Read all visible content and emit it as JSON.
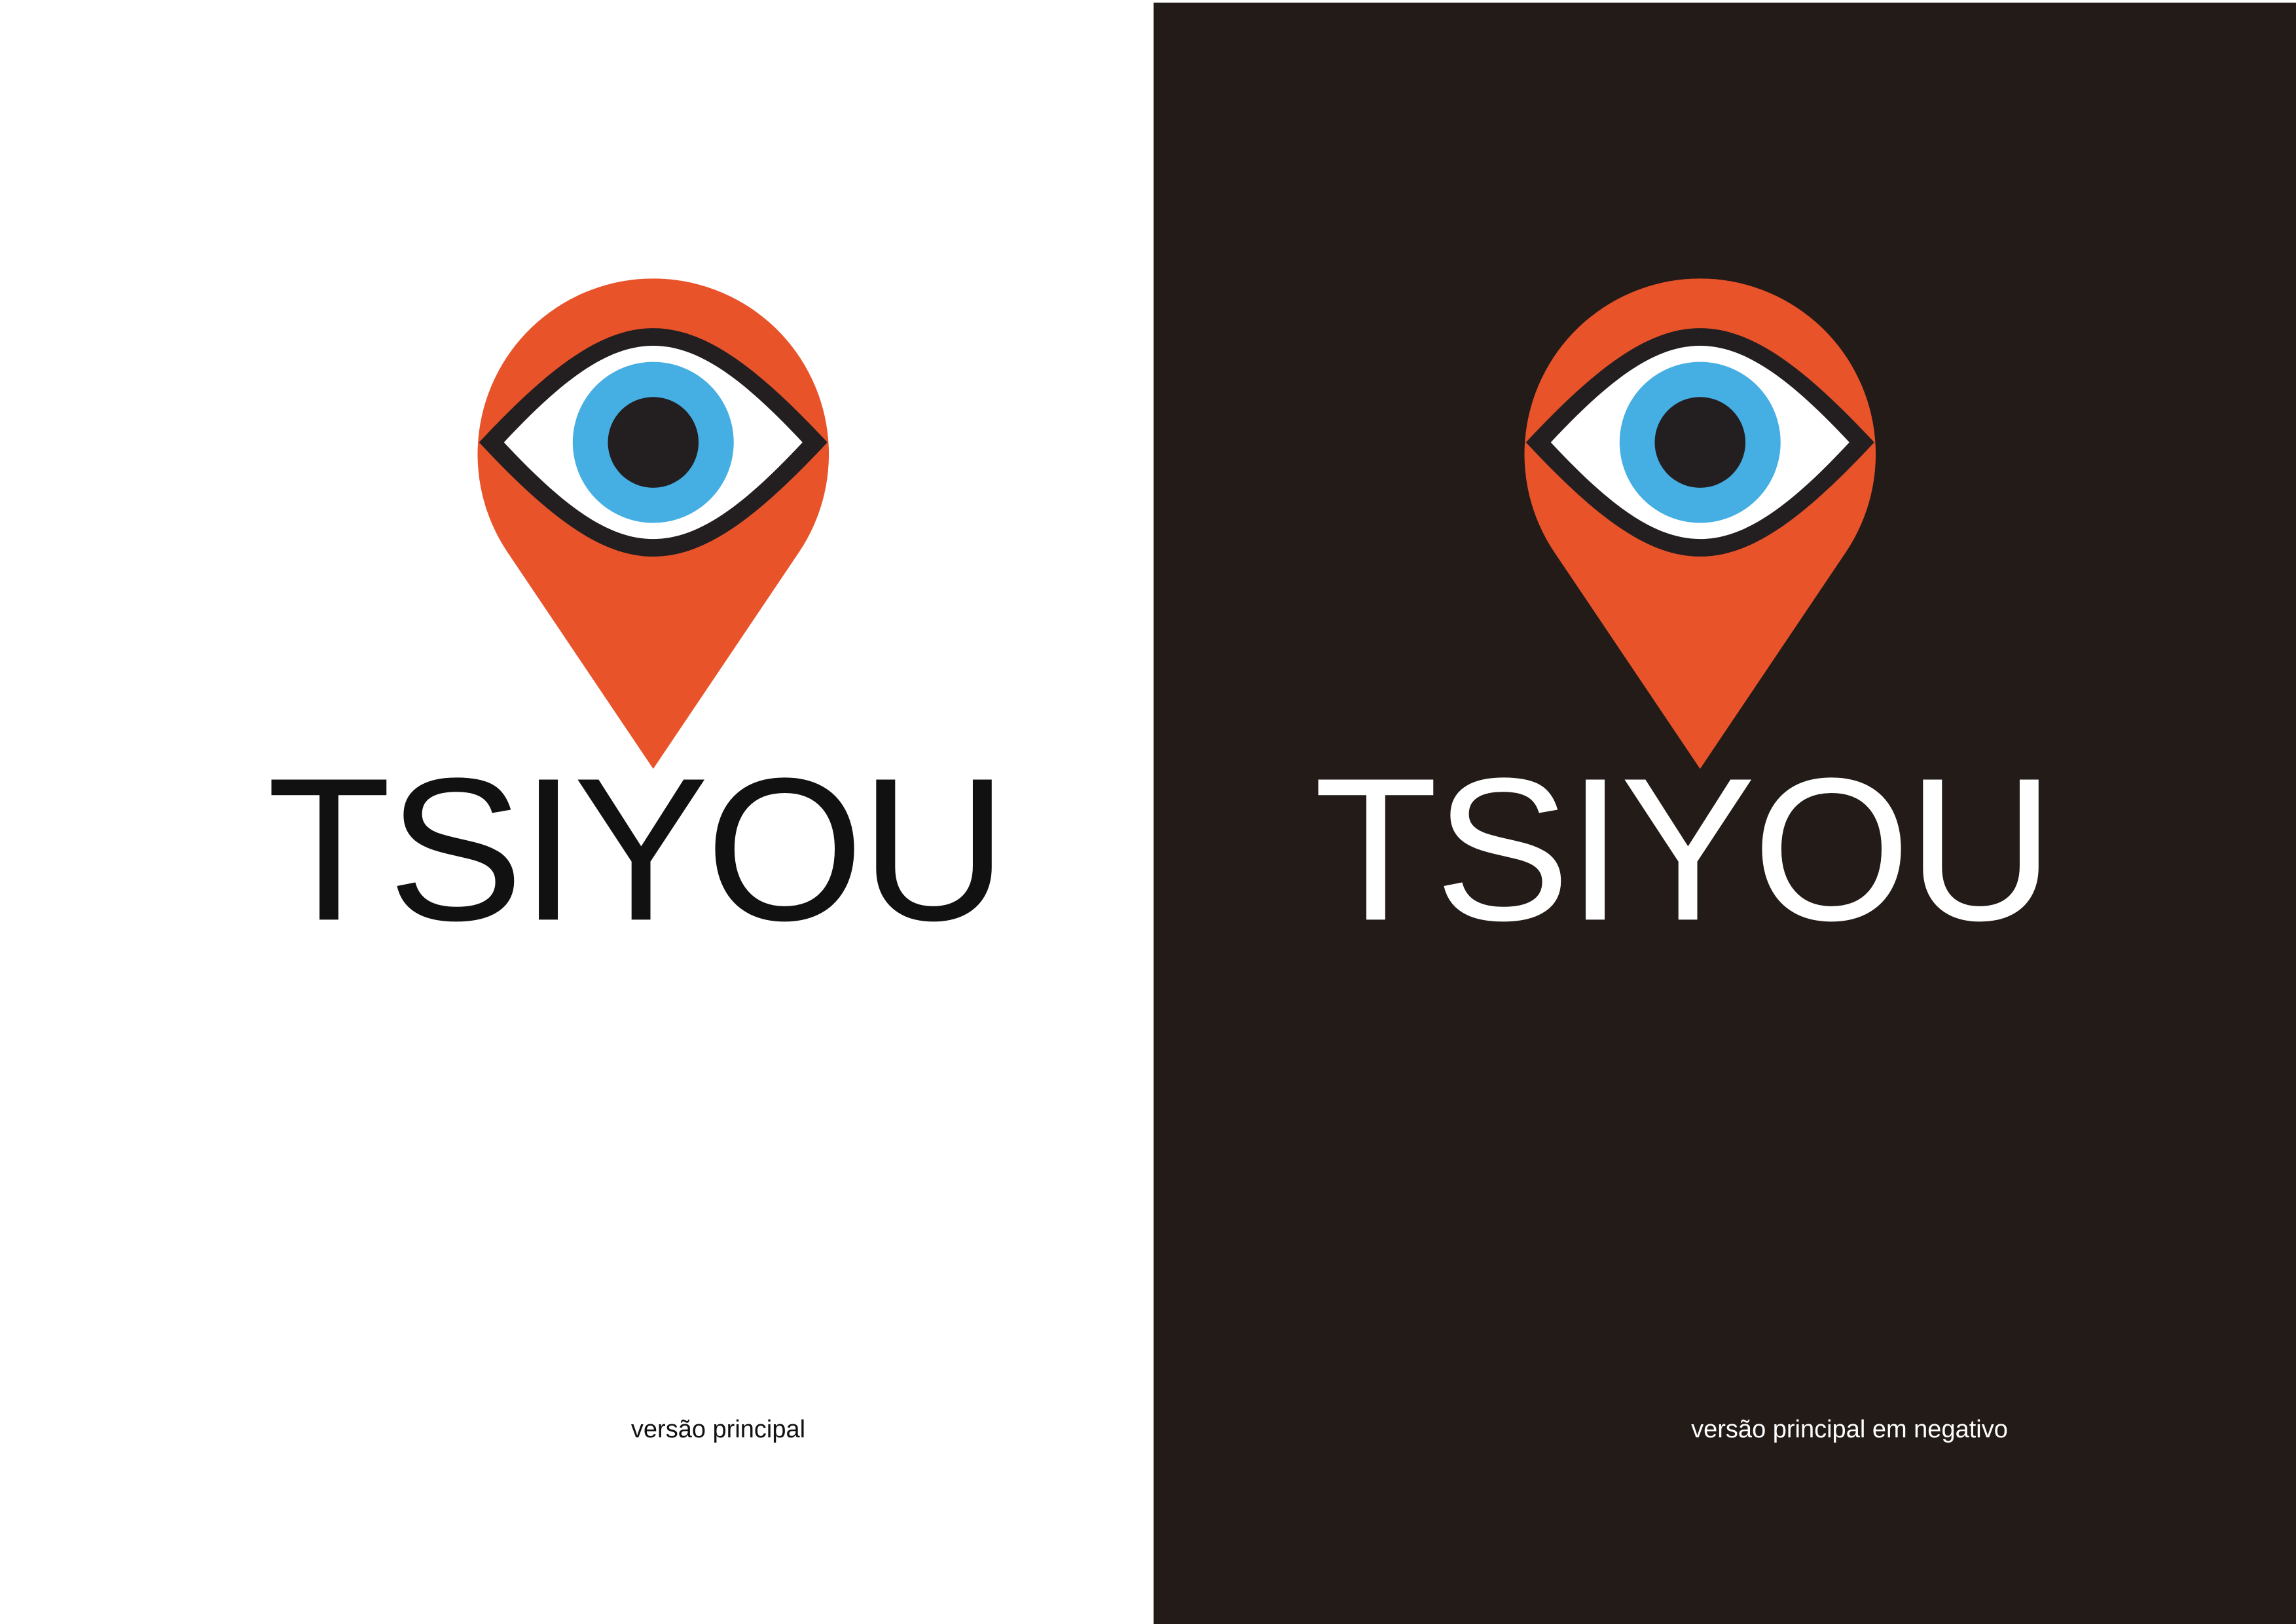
{
  "brand": {
    "wordmark": "TSIYOU",
    "logo_mark": "eye-in-map-pin-icon"
  },
  "versions": [
    {
      "caption": "versão principal",
      "background": "#ffffff",
      "wordmark_color": "#111111"
    },
    {
      "caption": "versão principal em negativo",
      "background": "#221b18",
      "wordmark_color": "#ffffff"
    }
  ],
  "colors": {
    "pin": "#e8532a",
    "iris": "#45aee3",
    "pupil": "#231f20",
    "eye_outline": "#231f20",
    "eye_white": "#ffffff"
  }
}
